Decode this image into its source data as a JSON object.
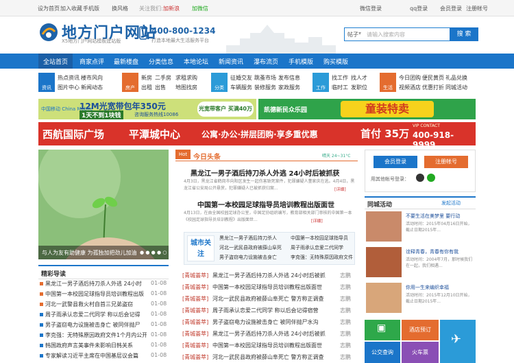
{
  "topbar": {
    "links": [
      "设为首页",
      "加入收藏",
      "手机版",
      "换风格",
      "关注我们:",
      "加新浪",
      "加微信"
    ],
    "right": [
      "微信登录",
      "qq登录",
      "会员登录",
      "注册帐号"
    ]
  },
  "logo": {
    "title": "地方门户网站",
    "subtitle": "X5地方门户网站模板建站版"
  },
  "hotline": {
    "number": "400-800-1234",
    "sub": "打造本地最大生活服务平台"
  },
  "search": {
    "category": "帖子",
    "placeholder": "请输入搜索内容",
    "button": "搜 索"
  },
  "nav": [
    "全站首页",
    "商家点评",
    "最新楼盘",
    "分类信息",
    "本地论坛",
    "新闻资讯",
    "瀑布流页",
    "手机模版",
    "购买模版"
  ],
  "categories": [
    {
      "icon": "资讯",
      "links": [
        "热点资讯",
        "楼市风向",
        "图片中心",
        "新闻动态"
      ]
    },
    {
      "icon": "房产",
      "links": [
        "新房",
        "二手房",
        "求租求购",
        "出租",
        "出售",
        "地图找房"
      ]
    },
    {
      "icon": "分类",
      "links": [
        "征婚交友",
        "跳蚤市场",
        "发布信息",
        "车辆服务",
        "装修服务",
        "家政服务"
      ]
    },
    {
      "icon": "工作",
      "links": [
        "找工作",
        "找人才",
        "临时工",
        "发职位"
      ]
    },
    {
      "icon": "生活",
      "links": [
        "今日团购",
        "便民黄页",
        "礼品兑换",
        "视频酒店",
        "优惠打折",
        "同城活动"
      ]
    }
  ],
  "ads": {
    "a1_big": "12M光宽带包年350元",
    "a1_small": "1天不到1块钱",
    "a1_note": "咨询服务热线10086",
    "mobile": "中国移动 China Mobile",
    "a2": "光宽带客户 买满40万",
    "a3_brand": "凯德新民众乐园",
    "a3_big": "童装特卖",
    "b1": "西航国际广场",
    "b2": "平潭城中心",
    "b3": "公寓·办公·拼层团购·享多重优惠",
    "b4": "首付 35万",
    "b5_label": "VIP CONTACT",
    "b5_phone": "400-918-9999"
  },
  "slider": {
    "caption": "与人为友有助健康 为孤独加把劲儿加油"
  },
  "jingcai": {
    "title": "精彩导读",
    "items": [
      {
        "t": "黑龙江一男子酒后持刀杀人外逃 24小时",
        "d": "01-08"
      },
      {
        "t": "中国第一本校园足球指导员培训教程出版",
        "d": "01-08"
      },
      {
        "t": "河北一武警县救火村自首三兄弟盗窃",
        "d": "01-08"
      },
      {
        "t": "周子雨承认恋爱二代同学 称以后会记得",
        "d": "01-08"
      },
      {
        "t": "男子盗窃电力设施被击身亡 被同伴抛尸",
        "d": "01-08"
      },
      {
        "t": "李克强：无特殊原因政府文件1个月内公开",
        "d": "01-08"
      },
      {
        "t": "韩国政府声言美事件未影响日韩关系",
        "d": "01-08"
      },
      {
        "t": "专家解读习近平主席在中国基层议会篇",
        "d": "01-08"
      }
    ]
  },
  "today": {
    "tag": "Hot",
    "title": "今日头条",
    "weather": "晴天 24~31°C",
    "h1": "黑龙江一男子酒后持刀杀人外逃 24小时后被抓获",
    "p1": "4月3日，黑龙江省鹤岗市向阳区发生一起伤害致死案件，犯罪嫌疑人董家庆在逃。4月4日，黑龙江省公安局公开悬赏，犯罪嫌疑人已被抓获归案...",
    "detail": "[详细]",
    "h2": "中国第一本校园足球指导员培训教程出版面世",
    "p2": "4月13日，在由全国校园足球办公室，中国足协组织编写，教育部相关部门审核的中国第一本《校园足球指导员培训教程》出版面世...",
    "city_label": "城市关注",
    "city_items": [
      "黑龙江一男子酒后持刀杀人",
      "河北一武民县政府被薛山阜死",
      "男子盗窃电力设施被击身亡",
      "中国第一本校园足球指导员",
      "周子雨承认恋爱二代同学",
      "李克强：无特殊原因政府文件"
    ],
    "news_tag": "[青城荟萃]",
    "news": [
      {
        "t": "黑龙江一男子酒后持刀杀人外逃 24小时后被抓",
        "src": "志鹏"
      },
      {
        "t": "中国第一本校园足球指导员培训教程出版面世",
        "src": "志鹏"
      },
      {
        "t": "河北一武民县政府被薛山阜死亡 警方称正调查",
        "src": "志鹏"
      },
      {
        "t": "周子雨承认恋爱二代同学 称以后会记得宿营",
        "src": "志鹏"
      },
      {
        "t": "男子盗窃电力设施被击身亡 被同伴抛尸水沟",
        "src": "志鹏"
      },
      {
        "t": "黑龙江一男子酒后持刀杀人外逃 24小时后被抓",
        "src": "志鹏"
      },
      {
        "t": "中国第一本校园足球指导员培训教程出版面世",
        "src": "志鹏"
      },
      {
        "t": "河北一武民县政府被薛山阜死亡 警方称正调查",
        "src": "志鹏"
      }
    ]
  },
  "sidebar": {
    "login": "会员登录",
    "register": "注册帐号",
    "quick": "用其他帐号登录：",
    "activity_title": "同城活动",
    "activity_more": "发起活动",
    "activities": [
      {
        "t": "不要生活在美梦里 要行动",
        "d": "活动时间：2015年04月16日开始，截止日期2015年..."
      },
      {
        "t": "诠释青春，青春有你有我",
        "d": "活动时间：2004年7月，那时候我们在一起，我们相遇..."
      },
      {
        "t": "你用一生来编织幸福",
        "d": "活动时间：2015年12月10日开始，截止日期2015年..."
      }
    ],
    "tiles": [
      "酒店预订",
      "公交查询",
      "火车票",
      "飞机票"
    ]
  }
}
